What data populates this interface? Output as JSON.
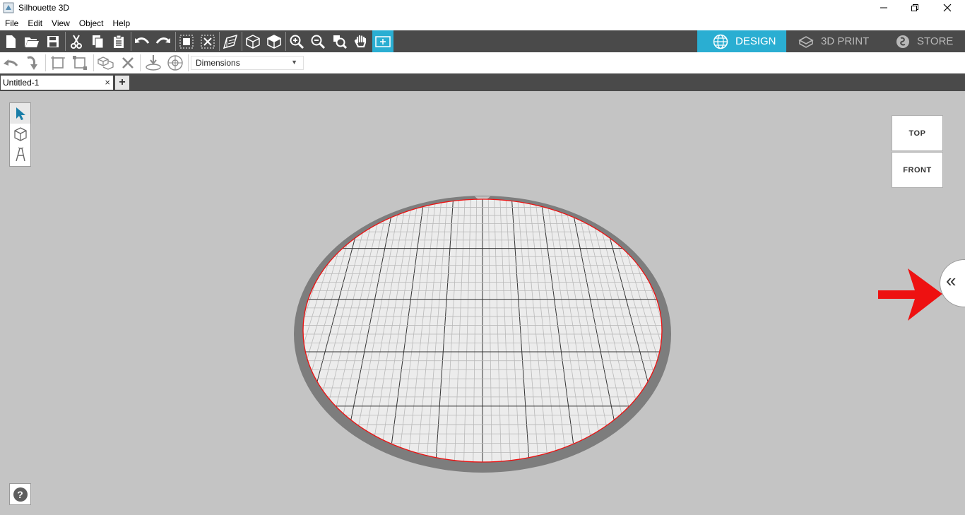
{
  "window": {
    "title": "Silhouette 3D",
    "controls": [
      "minimize-icon",
      "restore-icon",
      "close-icon"
    ]
  },
  "menu": [
    "File",
    "Edit",
    "View",
    "Object",
    "Help"
  ],
  "modes": [
    {
      "label": "DESIGN",
      "icon": "globe-icon",
      "active": true
    },
    {
      "label": "3D PRINT",
      "icon": "printer-icon",
      "active": false
    },
    {
      "label": "STORE",
      "icon": "store-icon",
      "active": false
    }
  ],
  "toolbar": {
    "dimensions_select": "Dimensions"
  },
  "document_tab": {
    "name": "Untitled-1",
    "close": "×",
    "add": "+"
  },
  "view_cube": {
    "top": "TOP",
    "front": "FRONT"
  },
  "help": "?",
  "panel_toggle": "«",
  "colors": {
    "accent": "#2aaed2",
    "toolbar_bg": "#4a4a4a",
    "canvas_bg": "#c4c4c4",
    "annotation_arrow": "#ee1111"
  }
}
